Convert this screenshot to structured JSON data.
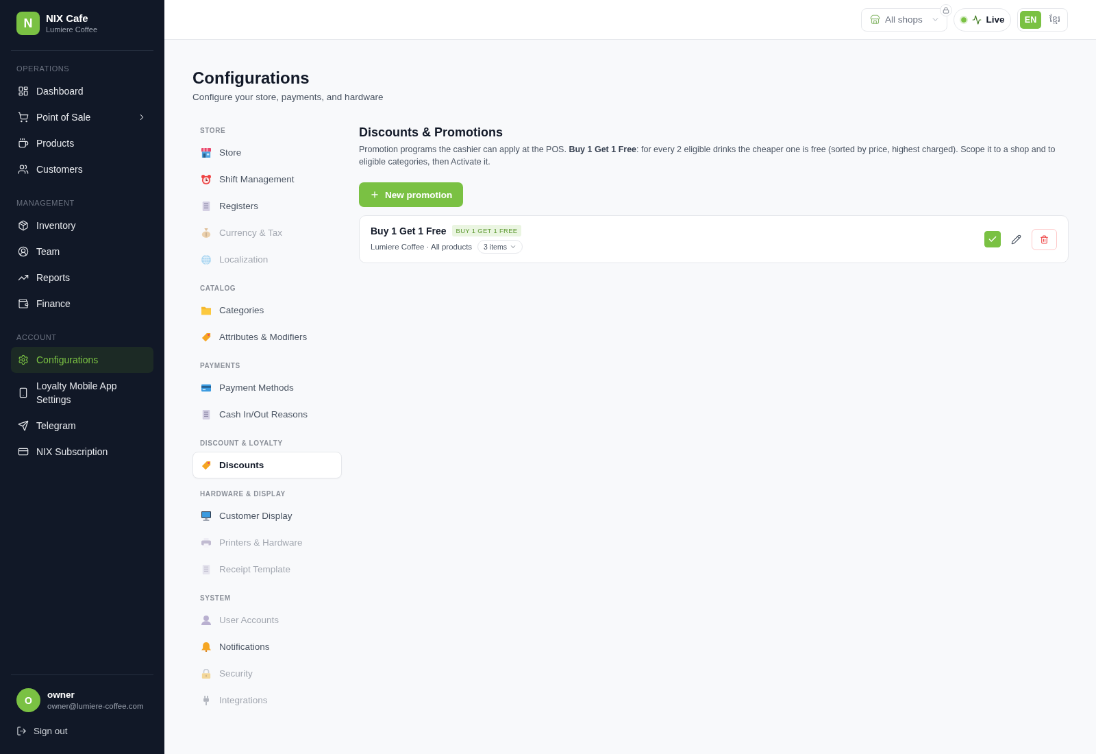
{
  "sidebar": {
    "brand": {
      "logo_letter": "N",
      "name": "NIX Cafe",
      "subtitle": "Lumiere Coffee"
    },
    "sections": [
      {
        "label": "OPERATIONS",
        "items": [
          {
            "label": "Dashboard",
            "kind": "link",
            "selected": false
          },
          {
            "label": "Point of Sale",
            "kind": "group",
            "selected": false
          },
          {
            "label": "Products",
            "kind": "link",
            "selected": false
          },
          {
            "label": "Customers",
            "kind": "link",
            "selected": false
          }
        ]
      },
      {
        "label": "MANAGEMENT",
        "items": [
          {
            "label": "Inventory",
            "kind": "link",
            "selected": false
          },
          {
            "label": "Team",
            "kind": "link",
            "selected": false
          },
          {
            "label": "Reports",
            "kind": "link",
            "selected": false
          },
          {
            "label": "Finance",
            "kind": "link",
            "selected": false
          }
        ]
      },
      {
        "label": "ACCOUNT",
        "items": [
          {
            "label": "Configurations",
            "kind": "link",
            "selected": true
          },
          {
            "label": "Loyalty Mobile App Settings",
            "kind": "link",
            "selected": false
          },
          {
            "label": "Telegram",
            "kind": "link",
            "selected": false
          },
          {
            "label": "NIX Subscription",
            "kind": "link",
            "selected": false
          }
        ]
      }
    ],
    "user": {
      "avatar_letter": "O",
      "name": "owner",
      "email": "owner@lumiere-coffee.com"
    },
    "sign_out": "Sign out"
  },
  "top_bar": {
    "shop_select": {
      "value": "All shops",
      "locked": true
    },
    "status": {
      "label": "Live",
      "online": true
    },
    "languages": [
      {
        "label": "EN",
        "selected": true
      },
      {
        "label": "ខ្មែរ",
        "selected": false
      }
    ]
  },
  "page": {
    "title": "Configurations",
    "subtitle": "Configure your store, payments, and hardware"
  },
  "config_nav": {
    "sections": [
      {
        "label": "STORE",
        "items": [
          {
            "label": "Store",
            "selected": false,
            "disabled": false
          },
          {
            "label": "Shift Management",
            "selected": false,
            "disabled": false
          },
          {
            "label": "Registers",
            "selected": false,
            "disabled": false
          },
          {
            "label": "Currency & Tax",
            "selected": false,
            "disabled": true
          },
          {
            "label": "Localization",
            "selected": false,
            "disabled": true
          }
        ]
      },
      {
        "label": "CATALOG",
        "items": [
          {
            "label": "Categories",
            "selected": false,
            "disabled": false
          },
          {
            "label": "Attributes & Modifiers",
            "selected": false,
            "disabled": false
          }
        ]
      },
      {
        "label": "PAYMENTS",
        "items": [
          {
            "label": "Payment Methods",
            "selected": false,
            "disabled": false
          },
          {
            "label": "Cash In/Out Reasons",
            "selected": false,
            "disabled": false
          }
        ]
      },
      {
        "label": "DISCOUNT & LOYALTY",
        "items": [
          {
            "label": "Discounts",
            "selected": true,
            "disabled": false
          }
        ]
      },
      {
        "label": "HARDWARE & DISPLAY",
        "items": [
          {
            "label": "Customer Display",
            "selected": false,
            "disabled": false
          },
          {
            "label": "Printers & Hardware",
            "selected": false,
            "disabled": true
          },
          {
            "label": "Receipt Template",
            "selected": false,
            "disabled": true
          }
        ]
      },
      {
        "label": "SYSTEM",
        "items": [
          {
            "label": "User Accounts",
            "selected": false,
            "disabled": true
          },
          {
            "label": "Notifications",
            "selected": false,
            "disabled": false
          },
          {
            "label": "Security",
            "selected": false,
            "disabled": true
          },
          {
            "label": "Integrations",
            "selected": false,
            "disabled": true
          }
        ]
      }
    ]
  },
  "panel": {
    "title": "Discounts & Promotions",
    "description": "Promotion programs the cashier can apply at the POS. **Buy 1 Get 1 Free**: for every 2 eligible drinks the cheaper one is free (sorted by price, highest charged). Scope it to a shop and to eligible categories, then Activate it.",
    "new_button": "New promotion",
    "promotions": [
      {
        "name": "Buy 1 Get 1 Free",
        "badge": "BUY 1 GET 1 FREE",
        "scope": "Lumiere Coffee · All products",
        "items": "3 items",
        "active": true
      }
    ]
  }
}
